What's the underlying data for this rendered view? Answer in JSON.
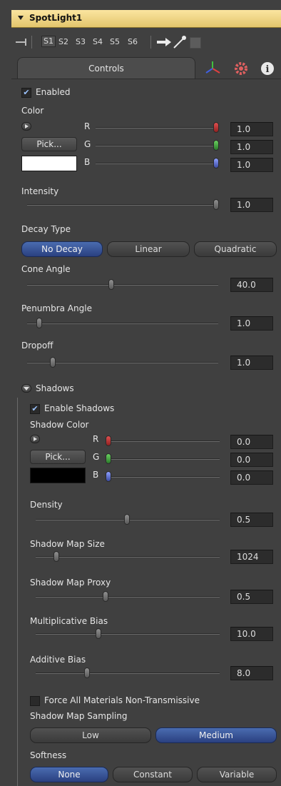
{
  "header": {
    "title": "SpotLight1"
  },
  "toolbar": {
    "slots": [
      "S1",
      "S2",
      "S3",
      "S4",
      "S5",
      "S6"
    ]
  },
  "tabs": {
    "controls": "Controls"
  },
  "enabled": {
    "label": "Enabled",
    "checked": true
  },
  "color": {
    "label": "Color",
    "pick_label": "Pick...",
    "swatch": "#ffffff",
    "channels": [
      {
        "label": "R",
        "value": "1.0",
        "level": 1.0
      },
      {
        "label": "G",
        "value": "1.0",
        "level": 1.0
      },
      {
        "label": "B",
        "value": "1.0",
        "level": 1.0
      }
    ]
  },
  "intensity": {
    "label": "Intensity",
    "value": "1.0",
    "level": 1.0
  },
  "decay": {
    "label": "Decay Type",
    "options": [
      "No Decay",
      "Linear",
      "Quadratic"
    ],
    "selected": "No Decay"
  },
  "cone_angle": {
    "label": "Cone Angle",
    "value": "40.0",
    "level": 0.44
  },
  "penumbra_angle": {
    "label": "Penumbra Angle",
    "value": "1.0",
    "level": 0.05
  },
  "dropoff": {
    "label": "Dropoff",
    "value": "1.0",
    "level": 0.2
  },
  "shadows": {
    "label": "Shadows",
    "enable": {
      "label": "Enable Shadows",
      "checked": true
    },
    "color": {
      "label": "Shadow Color",
      "pick_label": "Pick...",
      "swatch": "#000000",
      "channels": [
        {
          "label": "R",
          "value": "0.0",
          "level": 0.0
        },
        {
          "label": "G",
          "value": "0.0",
          "level": 0.0
        },
        {
          "label": "B",
          "value": "0.0",
          "level": 0.0
        }
      ]
    },
    "density": {
      "label": "Density",
      "value": "0.5",
      "level": 0.5
    },
    "map_size": {
      "label": "Shadow Map Size",
      "value": "1024",
      "level": 0.1
    },
    "map_proxy": {
      "label": "Shadow Map Proxy",
      "value": "0.5",
      "level": 0.37
    },
    "mult_bias": {
      "label": "Multiplicative Bias",
      "value": "10.0",
      "level": 0.33
    },
    "add_bias": {
      "label": "Additive Bias",
      "value": "8.0",
      "level": 0.27
    },
    "force_nontransmissive": {
      "label": "Force All Materials Non-Transmissive",
      "checked": false
    },
    "sampling": {
      "label": "Shadow Map Sampling",
      "options": [
        "Low",
        "Medium"
      ],
      "selected": "Medium"
    },
    "softness": {
      "label": "Softness",
      "options": [
        "None",
        "Constant",
        "Variable"
      ],
      "selected": "None"
    }
  },
  "colors": {
    "header_bg": "#f0d27f",
    "panel_bg": "#404040",
    "accent": "#3a5aa0"
  }
}
